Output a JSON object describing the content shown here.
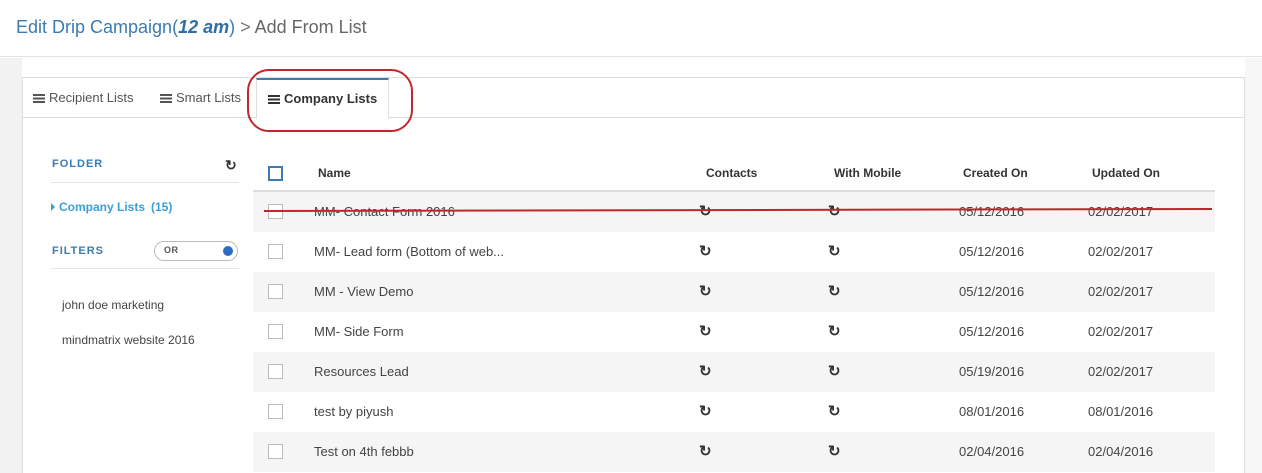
{
  "header": {
    "title_prefix": "Edit Drip Campaign(",
    "campaign_name": "12 am",
    "title_suffix": ")",
    "separator": " > ",
    "current_page": "Add From List"
  },
  "tabs": [
    {
      "label": "Recipient Lists",
      "icon": "list-icon",
      "active": false
    },
    {
      "label": "Smart Lists",
      "icon": "list-icon",
      "active": false
    },
    {
      "label": "Company Lists",
      "icon": "list-icon",
      "active": true
    }
  ],
  "sidebar": {
    "folder_heading": "FOLDER",
    "refresh_icon": "refresh-icon",
    "folder_item": {
      "label": "Company Lists",
      "count": "(15)"
    },
    "filters_heading": "FILTERS",
    "toggle_label": "OR",
    "filters": [
      "john doe marketing",
      "mindmatrix website 2016"
    ]
  },
  "table": {
    "columns": [
      "Name",
      "Contacts",
      "With Mobile",
      "Created On",
      "Updated On"
    ],
    "sync_icon": "sync-icon",
    "rows": [
      {
        "name": "MM- Contact Form 2016",
        "created": "05/12/2016",
        "updated": "02/02/2017"
      },
      {
        "name": "MM- Lead form (Bottom of web...",
        "created": "05/12/2016",
        "updated": "02/02/2017"
      },
      {
        "name": "MM - View Demo",
        "created": "05/12/2016",
        "updated": "02/02/2017"
      },
      {
        "name": "MM- Side Form",
        "created": "05/12/2016",
        "updated": "02/02/2017"
      },
      {
        "name": "Resources Lead",
        "created": "05/19/2016",
        "updated": "02/02/2017"
      },
      {
        "name": "test by piyush",
        "created": "08/01/2016",
        "updated": "08/01/2016"
      },
      {
        "name": "Test on 4th febbb",
        "created": "02/04/2016",
        "updated": "02/04/2016"
      }
    ]
  },
  "colors": {
    "accent": "#3b7bb0",
    "link": "#3aa0d6",
    "annotation": "#c0272d"
  }
}
